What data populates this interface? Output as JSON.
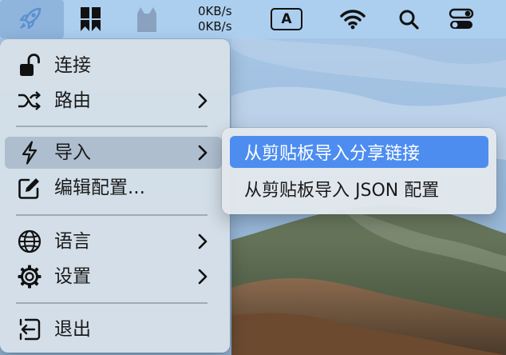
{
  "menubar": {
    "items": [
      {
        "name": "rocket-app-icon",
        "active": true
      },
      {
        "name": "bookmark-app-icon"
      },
      {
        "name": "cat-app-icon"
      }
    ],
    "netspeed_up": "0KB/s",
    "netspeed_down": "0KB/s",
    "input_source": "A"
  },
  "menu": {
    "items": [
      {
        "label": "连接",
        "icon": "unlock-icon"
      },
      {
        "label": "路由",
        "icon": "shuffle-icon",
        "submenu": true
      },
      {
        "label": "导入",
        "icon": "bolt-icon",
        "submenu": true,
        "highlighted": true
      },
      {
        "label": "编辑配置...",
        "icon": "edit-icon"
      },
      {
        "label": "语言",
        "icon": "globe-icon",
        "submenu": true
      },
      {
        "label": "设置",
        "icon": "gear-icon",
        "submenu": true
      },
      {
        "label": "退出",
        "icon": "exit-icon"
      }
    ]
  },
  "submenu": {
    "items": [
      {
        "label": "从剪贴板导入分享链接",
        "highlighted": true
      },
      {
        "label": "从剪贴板导入 JSON 配置"
      }
    ]
  },
  "colors": {
    "menubar": "#adcff0",
    "menu_bg": "#d5e0e8",
    "highlight": "#4d8df0",
    "menu_hover": "#aabacc"
  }
}
